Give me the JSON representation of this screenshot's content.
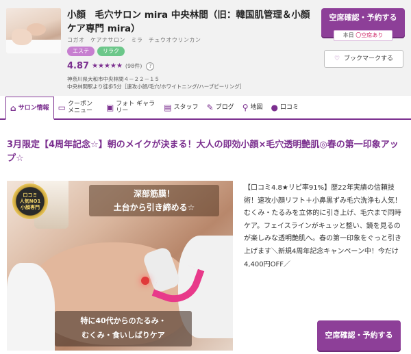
{
  "header": {
    "title": "小顔　毛穴サロン mira 中央林間（旧：韓国肌管理＆小顔ケア専門 mira）",
    "kana": "コガオ　ケアナサロン　ミラ　チュウオウリンカン",
    "tags": [
      "エステ",
      "リラク"
    ],
    "rating": "4.87",
    "stars": "★★★★★",
    "review_count": "(98件)",
    "help": "?",
    "address_line1": "神奈川県大和市中央林間４－２２－１５",
    "address_line2": "中央林間駅より徒歩5分［速攻小顔/毛穴/ホワイトニング/ハーブピーリング］",
    "reserve_label": "空席確認・予約する",
    "availability_prefix": "本日",
    "availability_status": "〇空席あり",
    "bookmark_label": "ブックマークする"
  },
  "tabs": [
    {
      "icon": "house-icon",
      "label": "サロン情報"
    },
    {
      "icon": "coupon-icon",
      "label": "クーポン メニュー"
    },
    {
      "icon": "photo-icon",
      "label": "フォト ギャラリー"
    },
    {
      "icon": "staff-icon",
      "label": "スタッフ"
    },
    {
      "icon": "pen-icon",
      "label": "ブログ"
    },
    {
      "icon": "map-pin-icon",
      "label": "地図"
    },
    {
      "icon": "chat-icon",
      "label": "口コミ"
    }
  ],
  "main": {
    "headline": "3月限定【4周年記念☆】朝のメイクが決まる！大人の即効小顔×毛穴透明艶肌◎春の第一印象アップ☆",
    "photo": {
      "badge_line1": "口コミ",
      "badge_line2": "人気NO1",
      "badge_line3": "小顔専門",
      "overlay_top_line1": "深部筋膜！",
      "overlay_top_line2": "土台から引き締める☆",
      "overlay_bottom_line1": "特に40代からのたるみ・",
      "overlay_bottom_line2": "むくみ・食いしばりケア"
    },
    "description": "【口コミ4.8★リピ率91%】歴22年実績の信頼技術！速攻小顔リフト＋小鼻黒ずみ毛穴洗浄も人気！むくみ・たるみを立体的に引き上げ、毛穴まで同時ケア。フェイスラインがキュッと整い、鏡を見るのが楽しみな透明艶肌へ。春の第一印象をぐっと引き上げます＼新規4周年記念キャンペーン中！今だけ4,400円OFF／",
    "reserve_label": "空席確認・予約する"
  },
  "colors": {
    "brand_purple": "#7b2f8f",
    "button_purple": "#8d3f98",
    "tag_esthe": "#c77fd0",
    "tag_relax": "#6cc78a"
  }
}
